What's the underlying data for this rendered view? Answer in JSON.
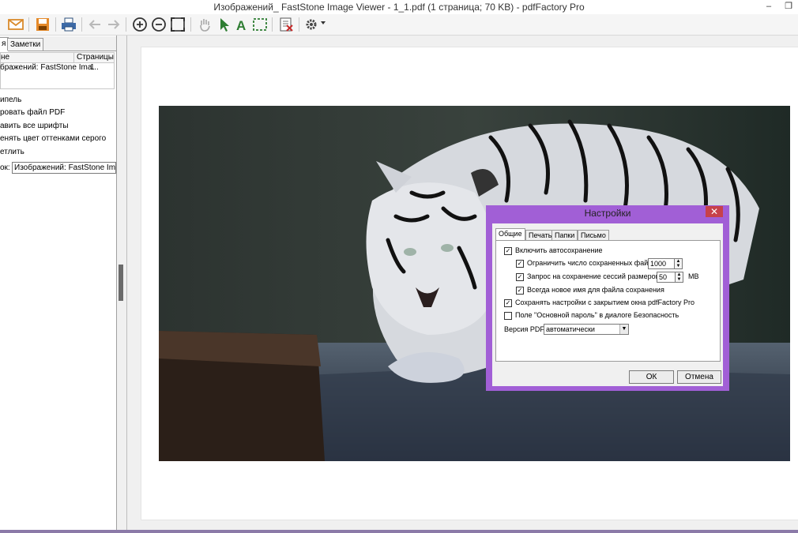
{
  "window": {
    "title": "Изображений_ FastStone Image Viewer - 1_1.pdf (1 страница; 70 KB) - pdfFactory Pro",
    "min_glyph": "–",
    "max_glyph": "❐"
  },
  "toolbar": {
    "icons": [
      "email-icon",
      "save-icon",
      "print-icon",
      "back-icon",
      "forward-icon",
      "zoom-in-icon",
      "zoom-out-icon",
      "fit-page-icon",
      "hand-icon",
      "select-arrow-icon",
      "text-tool-icon",
      "crop-selection-icon",
      "delete-page-icon",
      "settings-gear-icon"
    ]
  },
  "left_panel": {
    "tabs": [
      "я",
      "Заметки"
    ],
    "list_headers": [
      "не",
      "Страницы"
    ],
    "list_rows": [
      {
        "name": "бражений: FastStone Ima...",
        "pages": "1"
      }
    ],
    "options": [
      "ипель",
      "ровать файл PDF",
      "авить все шрифты",
      "енять цвет оттенками серого",
      "етлить"
    ],
    "title_label": "ок:",
    "title_value": "Изображений: FastStone Image V"
  },
  "dialog": {
    "title": "Настройки",
    "close_glyph": "✕",
    "tabs": [
      "Общие",
      "Печать",
      "Папки",
      "Письмо"
    ],
    "options": {
      "autosave": "Включить автосохранение",
      "limit_files": "Ограничить число сохраненных файлов",
      "limit_value": "1000",
      "session_prompt": "Запрос на сохранение сессий размером >",
      "session_value": "50",
      "session_unit": "MB",
      "new_name": "Всегда новое имя для файла сохранения",
      "save_settings": "Сохранять настройки с закрытием окна pdfFactory Pro",
      "password_field": "Поле \"Основной пароль\" в диалоге Безопасность",
      "pdf_version_label": "Версия PDF:",
      "pdf_version_value": "автоматически"
    },
    "ok_label": "ОК",
    "cancel_label": "Отмена"
  }
}
